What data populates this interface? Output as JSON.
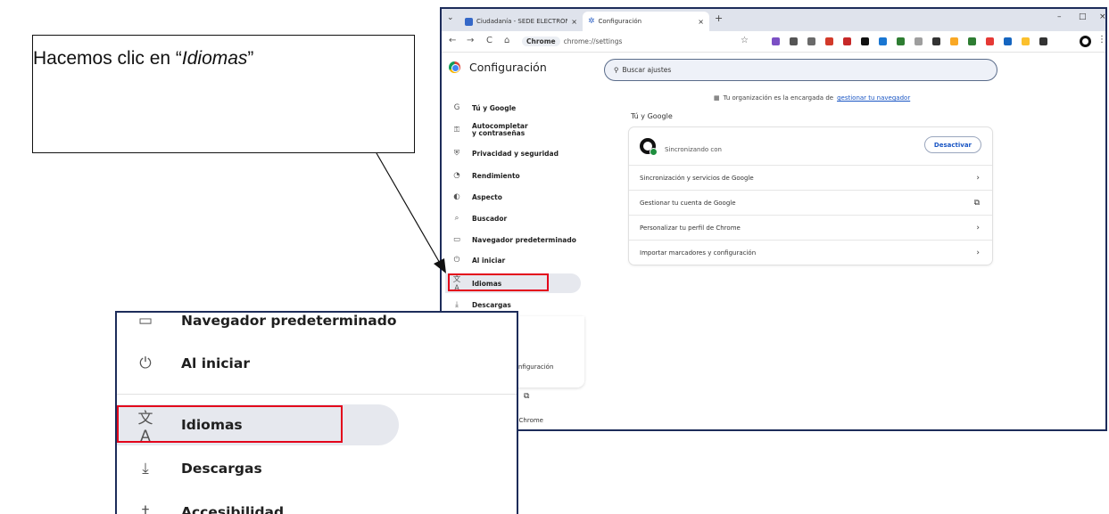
{
  "callout": {
    "before": "Hacemos clic en “",
    "emphasis": "Idiomas",
    "after": "”"
  },
  "browser": {
    "tabs": [
      {
        "title": "Ciudadanía - SEDE ELECTRÓNI",
        "close": "×"
      },
      {
        "title": "Configuración",
        "close": "×"
      }
    ],
    "new_tab": "+",
    "window_controls": {
      "minimize": "–",
      "maximize": "□",
      "close": "×"
    },
    "toolbar": {
      "chip": "Chrome",
      "url": "chrome://settings",
      "back_icon": "←",
      "forward_icon": "→",
      "reload_icon": "C",
      "home_icon": "⌂",
      "star_icon": "☆",
      "menu_icon": "⋮"
    },
    "extension_colors": [
      "#7b4fc4",
      "#555555",
      "#6a6a6a",
      "#d23a2a",
      "#c62828",
      "#111111",
      "#1976d2",
      "#2e7d32",
      "#9e9e9e",
      "#333333",
      "#f9a825",
      "#2e7d32",
      "#e53935",
      "#1565c0",
      "#fbc02d",
      "#333333"
    ]
  },
  "settings": {
    "app_title": "Configuración",
    "search_placeholder": "Buscar ajustes",
    "org_text": "Tu organización es la encargada de",
    "org_link": "gestionar tu navegador",
    "section_title": "Tú y Google",
    "sync_text": "Sincronizando con",
    "deactivate_button": "Desactivar",
    "rows": [
      {
        "label": "Sincronización y servicios de Google",
        "icon": "›"
      },
      {
        "label": "Gestionar tu cuenta de Google",
        "icon": "⧉"
      },
      {
        "label": "Personalizar tu perfil de Chrome",
        "icon": "›"
      },
      {
        "label": "Importar marcadores y configuración",
        "icon": "›"
      }
    ],
    "sidebar": [
      {
        "label": "Tú y Google",
        "icon": "G"
      },
      {
        "label": "Autocompletar y contraseñas",
        "icon": "⚿"
      },
      {
        "label": "Privacidad y seguridad",
        "icon": "⛨"
      },
      {
        "label": "Rendimiento",
        "icon": "◔"
      },
      {
        "label": "Aspecto",
        "icon": "◐"
      },
      {
        "label": "Buscador",
        "icon": "⌕"
      },
      {
        "label": "Navegador predeterminado",
        "icon": "▭"
      },
      {
        "label": "Al iniciar",
        "icon": "⏻"
      },
      {
        "label": "Idiomas",
        "icon": "文A"
      },
      {
        "label": "Descargas",
        "icon": "⤓"
      }
    ],
    "partial_texts": {
      "config": "nfiguración",
      "external": "⧉",
      "chrome": "e Chrome"
    }
  },
  "inset": {
    "items": [
      {
        "label": "Navegador predeterminado",
        "icon": "▭"
      },
      {
        "label": "Al iniciar",
        "icon": "⏻"
      },
      {
        "label": "Idiomas",
        "icon": "文A"
      },
      {
        "label": "Descargas",
        "icon": "⤓"
      },
      {
        "label": "Accesibilidad",
        "icon": "†"
      }
    ]
  }
}
